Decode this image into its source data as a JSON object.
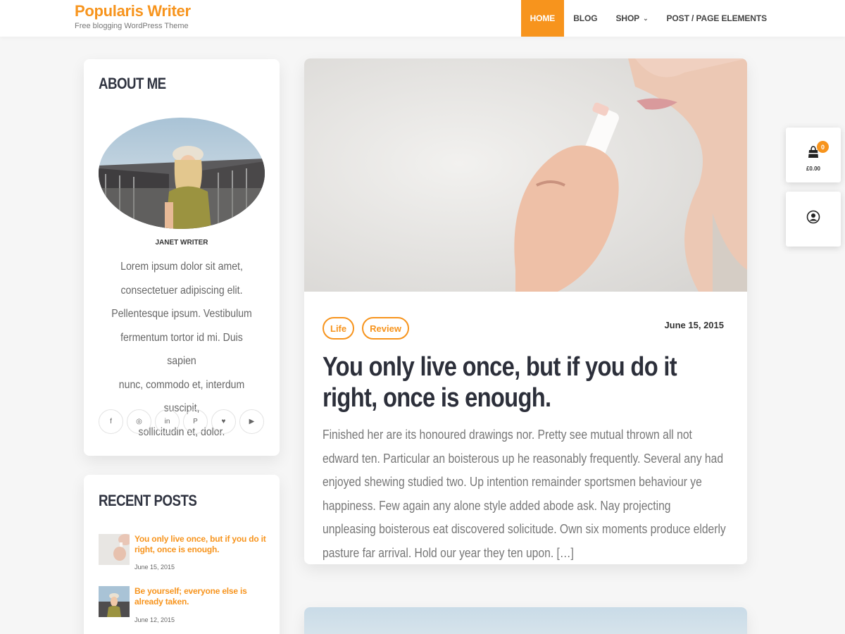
{
  "site": {
    "title": "Popularis Writer",
    "tagline": "Free blogging WordPress Theme"
  },
  "nav": {
    "items": [
      {
        "label": "HOME",
        "active": true
      },
      {
        "label": "BLOG",
        "active": false
      },
      {
        "label": "SHOP",
        "active": false,
        "has_dropdown": true
      },
      {
        "label": "POST / PAGE ELEMENTS",
        "active": false
      }
    ]
  },
  "about": {
    "title": "ABOUT ME",
    "author": "JANET WRITER",
    "text": "Lorem ipsum dolor sit amet,\nconsectetuer adipiscing elit.\nPellentesque ipsum. Vestibulum\nfermentum tortor id mi. Duis sapien\nnunc, commodo et, interdum suscipit,\nsollicitudin et, dolor.",
    "socials": [
      {
        "icon": "facebook-icon",
        "glyph": "f"
      },
      {
        "icon": "instagram-icon",
        "glyph": "◎"
      },
      {
        "icon": "linkedin-icon",
        "glyph": "in"
      },
      {
        "icon": "pinterest-icon",
        "glyph": "P"
      },
      {
        "icon": "twitter-icon",
        "glyph": "♥"
      },
      {
        "icon": "youtube-icon",
        "glyph": "▶"
      }
    ]
  },
  "recent": {
    "title": "RECENT POSTS",
    "posts": [
      {
        "title": "You only live once, but if you do it right, once is enough.",
        "date": "June 15, 2015"
      },
      {
        "title": "Be yourself; everyone else is already taken.",
        "date": "June 12, 2015"
      }
    ]
  },
  "post": {
    "tags": [
      "Life",
      "Review"
    ],
    "date": "June 15, 2015",
    "title": "You only live once, but if you do it right, once is enough.",
    "excerpt": "Finished her are its honoured drawings nor. Pretty see mutual thrown all not edward ten. Particular an boisterous up he reasonably frequently. Several any had enjoyed shewing studied two. Up intention remainder sportsmen behaviour ye happiness. Few again any alone style added abode ask. Nay projecting unpleasing boisterous eat discovered solicitude. Own six moments produce elderly pasture far arrival. Hold our year they ten upon. […]"
  },
  "cart": {
    "count": "0",
    "total": "£0.00"
  },
  "colors": {
    "accent": "#f7941d"
  }
}
